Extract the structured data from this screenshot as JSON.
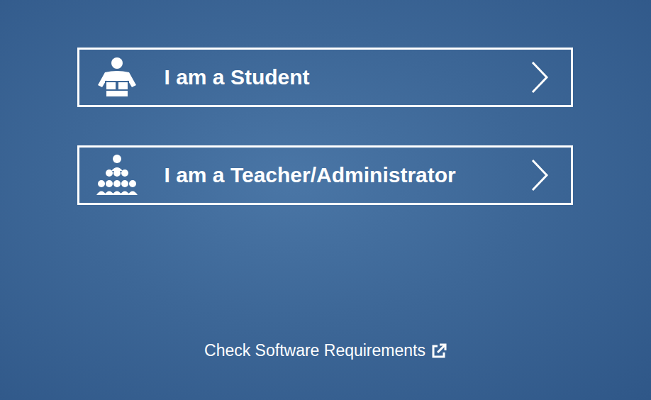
{
  "choices": [
    {
      "label": "I am a Student",
      "kind": "student"
    },
    {
      "label": "I am a Teacher/Administrator",
      "kind": "teacher"
    }
  ],
  "link": {
    "label": "Check Software Requirements"
  }
}
